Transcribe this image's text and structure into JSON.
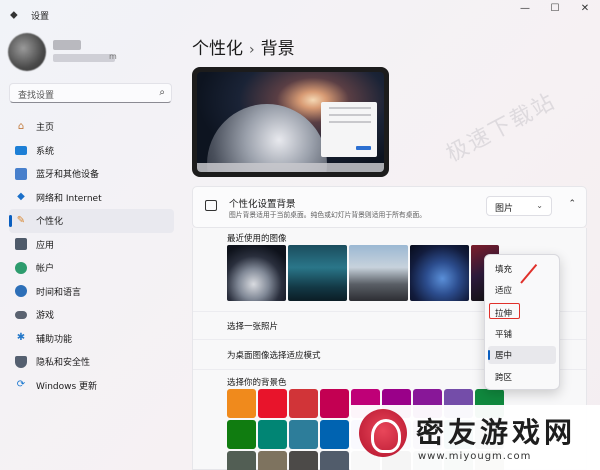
{
  "window": {
    "back_glyph": "⬥",
    "title": "设置",
    "controls": [
      "—",
      "☐",
      "✕"
    ]
  },
  "profile": {
    "email_suffix": "m"
  },
  "search": {
    "placeholder": "查找设置"
  },
  "sidebar": {
    "items": [
      {
        "label": "主页",
        "icon": "home-icon",
        "color": "#c27a3d"
      },
      {
        "label": "系统",
        "icon": "system-icon",
        "color": "#1d7fd6"
      },
      {
        "label": "蓝牙和其他设备",
        "icon": "bluetooth-icon",
        "color": "#2a6cc4"
      },
      {
        "label": "网络和 Internet",
        "icon": "network-icon",
        "color": "#1a6fc9"
      },
      {
        "label": "个性化",
        "icon": "brush-icon",
        "color": "#d8842b",
        "active": true
      },
      {
        "label": "应用",
        "icon": "apps-icon",
        "color": "#4e5a6a"
      },
      {
        "label": "帐户",
        "icon": "account-icon",
        "color": "#2d9c6e"
      },
      {
        "label": "时间和语言",
        "icon": "time-language-icon",
        "color": "#2d6fb8"
      },
      {
        "label": "游戏",
        "icon": "gaming-icon",
        "color": "#5a6270"
      },
      {
        "label": "辅助功能",
        "icon": "accessibility-icon",
        "color": "#2579c9"
      },
      {
        "label": "隐私和安全性",
        "icon": "shield-icon",
        "color": "#556070"
      },
      {
        "label": "Windows 更新",
        "icon": "update-icon",
        "color": "#1a78d0"
      }
    ]
  },
  "header": {
    "crumb_parent": "个性化",
    "separator": "›",
    "crumb_current": "背景"
  },
  "watermark": "极速下载站",
  "background_card": {
    "title": "个性化设置背景",
    "description": "图片背景适用于当前桌面。纯色或幻灯片背景则适用于所有桌面。",
    "dropdown_value": "图片",
    "dropdown_chevron": "⌄",
    "collapse_chevron": "⌃"
  },
  "panel": {
    "recent_label": "最近使用的图像",
    "choose_photo": "选择一张照片",
    "fit_label": "为桌面图像选择适应模式",
    "bg_color_label": "选择你的背景色",
    "swatches": [
      "#f08a1c",
      "#e8142b",
      "#d13438",
      "#c30052",
      "#bf0077",
      "#9a0089",
      "#881798",
      "#744da9",
      "#10893e",
      "#107c10",
      "#018574",
      "#2d7d9a",
      "#0063b1",
      "#6b69d6",
      "#8e8cd8",
      "#8764b8",
      "#038387",
      "#486860",
      "#525e54",
      "#7e735f",
      "#4c4a48",
      "#515c6b",
      "#4a5459",
      "#000000",
      "#68768a",
      "#567c73",
      "#7a7574"
    ]
  },
  "fit_menu": {
    "options": [
      "填充",
      "适应",
      "拉伸",
      "平铺",
      "居中",
      "跨区"
    ],
    "selected": "居中",
    "highlighted": "拉伸"
  },
  "logo": {
    "name": "密友游戏网",
    "url": "www.miyougm.com"
  }
}
